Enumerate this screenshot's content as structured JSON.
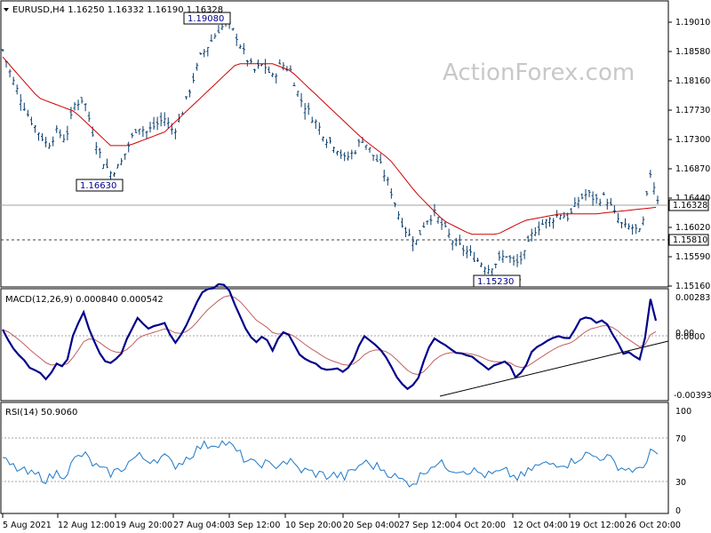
{
  "main_panel": {
    "header": "EURUSD,H4  1.16250 1.16332 1.16190 1.16328",
    "watermark": "ActionForex.com",
    "price_ticks": [
      "1.19010",
      "1.18580",
      "1.18160",
      "1.17730",
      "1.17300",
      "1.16870",
      "1.16440",
      "1.16020",
      "1.15590",
      "1.15160"
    ],
    "current_price": "1.16328",
    "support_level": "1.15810",
    "annotations": [
      "1.19080",
      "1.16630",
      "1.15230"
    ]
  },
  "macd_panel": {
    "header": "MACD(12,26,9) 0.000840 0.000542",
    "ticks": [
      "0.00283",
      "0.00",
      "0.0000",
      "-0.003939"
    ]
  },
  "rsi_panel": {
    "header": "RSI(14) 50.9060",
    "ticks": [
      "100",
      "70",
      "30",
      "0"
    ]
  },
  "x_axis": {
    "labels": [
      "5 Aug 2021",
      "12 Aug 12:00",
      "19 Aug 20:00",
      "27 Aug 04:00",
      "3 Sep 12:00",
      "10 Sep 20:00",
      "20 Sep 04:00",
      "27 Sep 12:00",
      "4 Oct 20:00",
      "12 Oct 04:00",
      "19 Oct 12:00",
      "26 Oct 20:00"
    ]
  },
  "colors": {
    "bars": "#0a3d6b",
    "ma": "#d00000",
    "macd": "#00008b",
    "signal": "#c06060",
    "rsi": "#1e78c8",
    "trendline": "#000000"
  },
  "chart_data": [
    {
      "type": "ohlc",
      "symbol": "EURUSD",
      "timeframe": "H4",
      "last_bar": {
        "open": 1.1625,
        "high": 1.16332,
        "low": 1.1619,
        "close": 1.16328
      },
      "ylim": [
        1.15,
        1.194
      ],
      "x_start": "5 Aug 2021",
      "x_end": "29 Oct 2021",
      "bar_count": 250,
      "swing_points": [
        {
          "label": "1.16630",
          "value": 1.1663,
          "type": "low",
          "near": "16 Aug 2021"
        },
        {
          "label": "1.19080",
          "value": 1.1908,
          "type": "high",
          "near": "3 Sep 2021"
        },
        {
          "label": "1.15230",
          "value": 1.1523,
          "type": "low",
          "near": "12 Oct 2021"
        }
      ],
      "close_path": [
        [
          0,
          1.186
        ],
        [
          5,
          1.182
        ],
        [
          15,
          1.176
        ],
        [
          25,
          1.172
        ],
        [
          30,
          1.174
        ],
        [
          35,
          1.173
        ],
        [
          40,
          1.178
        ],
        [
          45,
          1.179
        ],
        [
          50,
          1.174
        ],
        [
          55,
          1.17
        ],
        [
          60,
          1.168
        ],
        [
          65,
          1.169
        ],
        [
          70,
          1.172
        ],
        [
          75,
          1.175
        ],
        [
          80,
          1.174
        ],
        [
          85,
          1.175
        ],
        [
          90,
          1.176
        ],
        [
          95,
          1.174
        ],
        [
          100,
          1.177
        ],
        [
          105,
          1.181
        ],
        [
          110,
          1.185
        ],
        [
          115,
          1.187
        ],
        [
          120,
          1.189
        ],
        [
          125,
          1.19
        ],
        [
          130,
          1.188
        ],
        [
          135,
          1.185
        ],
        [
          140,
          1.183
        ],
        [
          145,
          1.184
        ],
        [
          150,
          1.182
        ],
        [
          155,
          1.184
        ],
        [
          160,
          1.183
        ],
        [
          165,
          1.179
        ],
        [
          170,
          1.177
        ],
        [
          175,
          1.175
        ],
        [
          180,
          1.173
        ],
        [
          185,
          1.172
        ],
        [
          190,
          1.17
        ],
        [
          195,
          1.171
        ],
        [
          200,
          1.173
        ],
        [
          205,
          1.171
        ],
        [
          210,
          1.169
        ],
        [
          215,
          1.166
        ],
        [
          220,
          1.162
        ],
        [
          225,
          1.159
        ],
        [
          230,
          1.158
        ],
        [
          235,
          1.161
        ],
        [
          240,
          1.162
        ],
        [
          245,
          1.16
        ],
        [
          250,
          1.158
        ]
      ],
      "ma_path": [
        [
          0,
          1.185
        ],
        [
          20,
          1.179
        ],
        [
          40,
          1.177
        ],
        [
          60,
          1.172
        ],
        [
          70,
          1.172
        ],
        [
          90,
          1.174
        ],
        [
          110,
          1.179
        ],
        [
          130,
          1.184
        ],
        [
          150,
          1.184
        ],
        [
          160,
          1.183
        ],
        [
          180,
          1.178
        ],
        [
          200,
          1.173
        ],
        [
          215,
          1.17
        ],
        [
          230,
          1.165
        ],
        [
          245,
          1.161
        ],
        [
          260,
          1.159
        ],
        [
          275,
          1.159
        ],
        [
          290,
          1.161
        ],
        [
          310,
          1.162
        ],
        [
          330,
          1.162
        ]
      ],
      "recent_path": [
        [
          250,
          1.158
        ],
        [
          260,
          1.156
        ],
        [
          270,
          1.154
        ],
        [
          280,
          1.156
        ],
        [
          285,
          1.1545
        ],
        [
          290,
          1.156
        ],
        [
          295,
          1.1595
        ],
        [
          300,
          1.1605
        ],
        [
          310,
          1.162
        ],
        [
          315,
          1.1615
        ],
        [
          320,
          1.164
        ],
        [
          325,
          1.165
        ],
        [
          330,
          1.164
        ],
        [
          335,
          1.1645
        ],
        [
          340,
          1.162
        ],
        [
          345,
          1.16
        ],
        [
          350,
          1.16
        ],
        [
          355,
          1.159
        ],
        [
          360,
          1.168
        ],
        [
          365,
          1.1633
        ]
      ]
    },
    {
      "type": "line",
      "name": "MACD(12,26,9)",
      "values": {
        "macd": 0.00084,
        "signal": 0.000542
      },
      "ylim": [
        -0.003939,
        0.00283
      ]
    },
    {
      "type": "line",
      "name": "RSI(14)",
      "values": {
        "rsi": 50.906
      },
      "ylim": [
        0,
        100
      ],
      "levels": [
        70,
        30
      ]
    }
  ]
}
